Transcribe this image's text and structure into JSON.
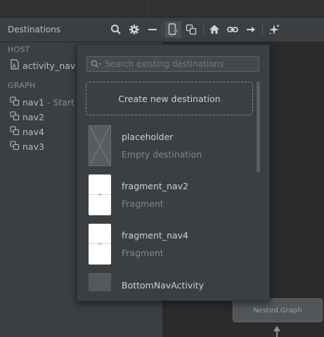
{
  "panel": {
    "title": "Destinations"
  },
  "toolbar": {
    "icons": [
      "search-icon",
      "gear-icon",
      "minus-icon",
      "new-destination-icon",
      "nested-graph-icon",
      "home-icon",
      "link-icon",
      "arrow-right-icon",
      "auto-arrange-icon"
    ]
  },
  "sidebar": {
    "host_label": "HOST",
    "host_item": "activity_nav (f",
    "graph_label": "GRAPH",
    "graph_items": [
      {
        "label": "nav1",
        "suffix": "- Start"
      },
      {
        "label": "nav2"
      },
      {
        "label": "nav4"
      },
      {
        "label": "nav3"
      }
    ]
  },
  "popup": {
    "search_placeholder": "Search existing destinations",
    "create_label": "Create new destination",
    "destinations": [
      {
        "name": "placeholder",
        "type": "Empty destination",
        "thumb": "placeholder"
      },
      {
        "name": "fragment_nav2",
        "type": "Fragment",
        "thumb": "fragment"
      },
      {
        "name": "fragment_nav4",
        "type": "Fragment",
        "thumb": "fragment"
      },
      {
        "name": "BottomNavActivity",
        "thumb": "activity"
      }
    ]
  },
  "canvas": {
    "nested_graph_label": "Nested Graph"
  },
  "colors": {
    "panel_bg": "#3c3f41",
    "canvas_bg": "#2b2b2b",
    "accent_green": "#59a869"
  }
}
